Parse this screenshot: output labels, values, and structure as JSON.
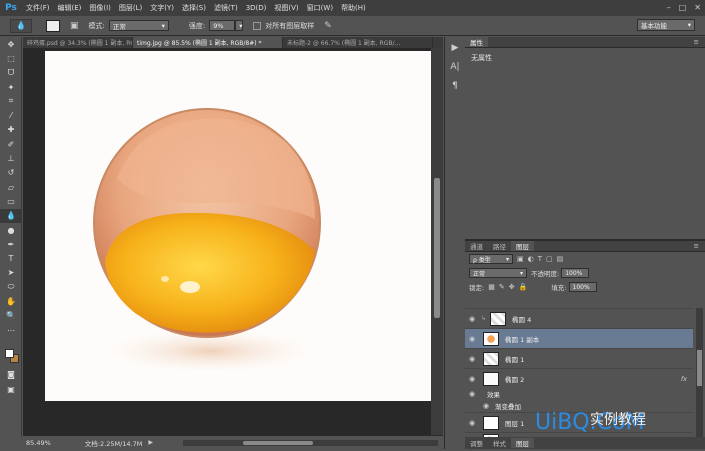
{
  "app": {
    "logo": "Ps"
  },
  "menu": [
    "文件(F)",
    "编辑(E)",
    "图像(I)",
    "图层(L)",
    "文字(Y)",
    "选择(S)",
    "滤镜(T)",
    "3D(D)",
    "视图(V)",
    "窗口(W)",
    "帮助(H)"
  ],
  "options": {
    "mode_label": "模式:",
    "mode_value": "正常",
    "opacity_label": "强度:",
    "opacity_value": "9%",
    "sample_all_label": "对所有图层取样",
    "workspace": "基本功能"
  },
  "tabs": [
    {
      "label": "碎鸡蛋.psd @ 34.3% (椭圆 1 副本, RG...",
      "active": false
    },
    {
      "label": "timg.jpg @ 85.5% (椭圆 1 副本, RGB/8#) *",
      "active": true
    },
    {
      "label": "未标题-2 @ 66.7% (椭圆 1 副本, RGB/...",
      "active": false
    }
  ],
  "status": {
    "zoom": "85.49%",
    "doc": "文档:2.25M/14.7M"
  },
  "properties": {
    "tab": "属性",
    "body": "无属性"
  },
  "layers_panel": {
    "tabs": [
      "通道",
      "路径",
      "图层"
    ],
    "filter_label": "ρ 类型",
    "blend_mode": "正常",
    "opacity_label": "不透明度:",
    "opacity_value": "100%",
    "lock_label": "锁定:",
    "fill_label": "填充:",
    "fill_value": "100%",
    "layers": [
      {
        "name": "椭圆 4",
        "selected": false
      },
      {
        "name": "椭圆 1 副本",
        "selected": true
      },
      {
        "name": "椭圆 1",
        "selected": false
      },
      {
        "name": "椭圆 2",
        "selected": false,
        "fx": "fx"
      },
      {
        "name": "效果",
        "sub": true
      },
      {
        "name": "渐变叠加",
        "sub": true
      },
      {
        "name": "图层 1",
        "selected": false
      },
      {
        "name": "背景",
        "selected": false
      }
    ],
    "footer_tabs": [
      "调整",
      "样式",
      "图层"
    ]
  },
  "watermark": {
    "logo": "UiBQ.CoM",
    "text": "实例教程"
  }
}
